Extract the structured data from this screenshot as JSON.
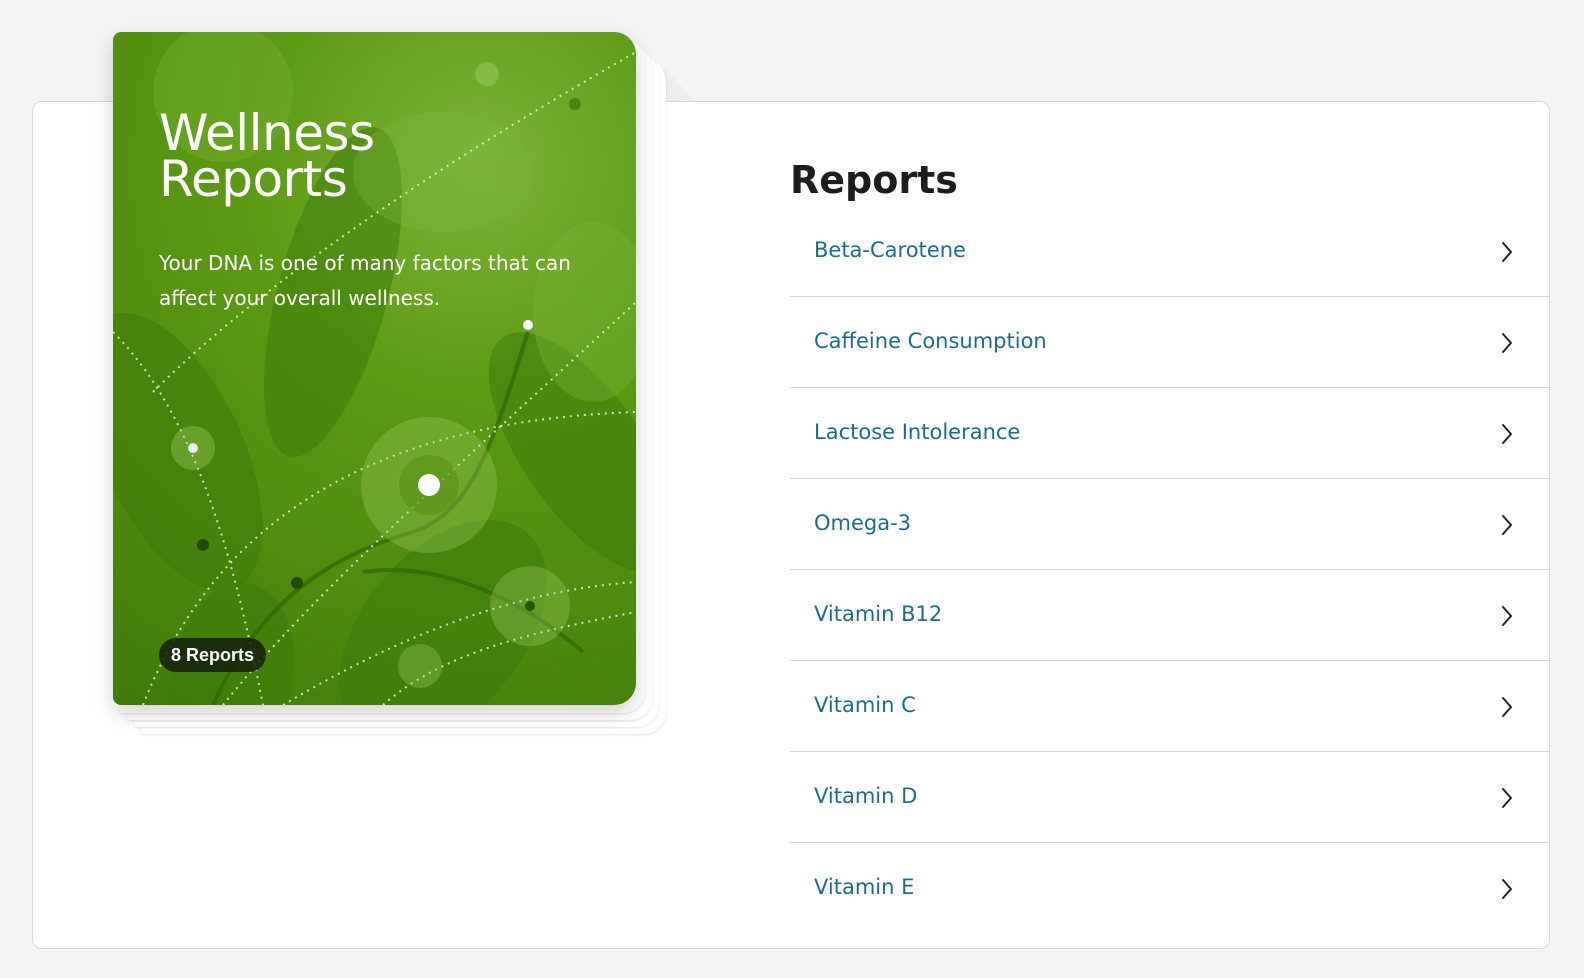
{
  "card": {
    "title": "Wellness Reports",
    "description": "Your DNA is one of many factors that can affect your overall wellness.",
    "badge": "8 Reports"
  },
  "reports": {
    "heading": "Reports",
    "items": [
      {
        "label": "Beta-Carotene"
      },
      {
        "label": "Caffeine Consumption"
      },
      {
        "label": "Lactose Intolerance"
      },
      {
        "label": "Omega-3"
      },
      {
        "label": "Vitamin B12"
      },
      {
        "label": "Vitamin C"
      },
      {
        "label": "Vitamin D"
      },
      {
        "label": "Vitamin E"
      }
    ]
  },
  "colors": {
    "link": "#1a6c8e",
    "card_green": "#5c9a14",
    "badge_bg": "#1c2410",
    "heading": "#1d1d1d"
  },
  "icons": {
    "row_arrow": "chevron-right-icon"
  }
}
